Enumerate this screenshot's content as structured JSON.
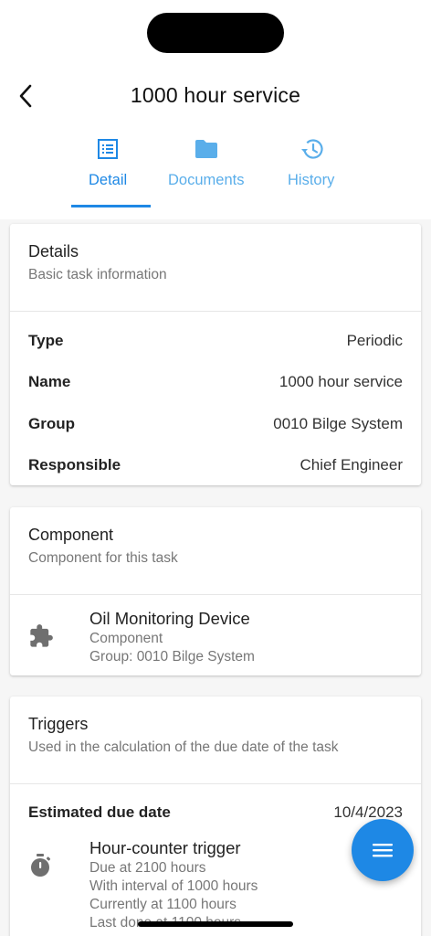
{
  "header": {
    "title": "1000 hour service"
  },
  "tabs": [
    {
      "label": "Detail",
      "icon": "list-alt-icon",
      "active": true
    },
    {
      "label": "Documents",
      "icon": "folder-icon",
      "active": false
    },
    {
      "label": "History",
      "icon": "history-icon",
      "active": false
    }
  ],
  "details": {
    "title": "Details",
    "subtitle": "Basic task information",
    "rows": [
      {
        "label": "Type",
        "value": "Periodic"
      },
      {
        "label": "Name",
        "value": "1000 hour service"
      },
      {
        "label": "Group",
        "value": "0010 Bilge System"
      },
      {
        "label": "Responsible",
        "value": "Chief Engineer"
      }
    ]
  },
  "component": {
    "title": "Component",
    "subtitle": "Component for this task",
    "item": {
      "icon": "puzzle-piece-icon",
      "name": "Oil Monitoring Device",
      "type": "Component",
      "group": "Group: 0010 Bilge System"
    }
  },
  "triggers": {
    "title": "Triggers",
    "subtitle": "Used in the calculation of the due date of the task",
    "due_label": "Estimated due date",
    "due_value": "10/4/2023",
    "item": {
      "icon": "stopwatch-icon",
      "name": "Hour-counter trigger",
      "lines": [
        "Due at 2100 hours",
        "With interval of 1000 hours",
        "Currently at 1100 hours",
        "Last done at 1100 hours"
      ]
    }
  },
  "fab": {
    "icon": "menu-icon"
  },
  "colors": {
    "accent": "#1e88e5",
    "tab_inactive": "#5aaeea"
  }
}
